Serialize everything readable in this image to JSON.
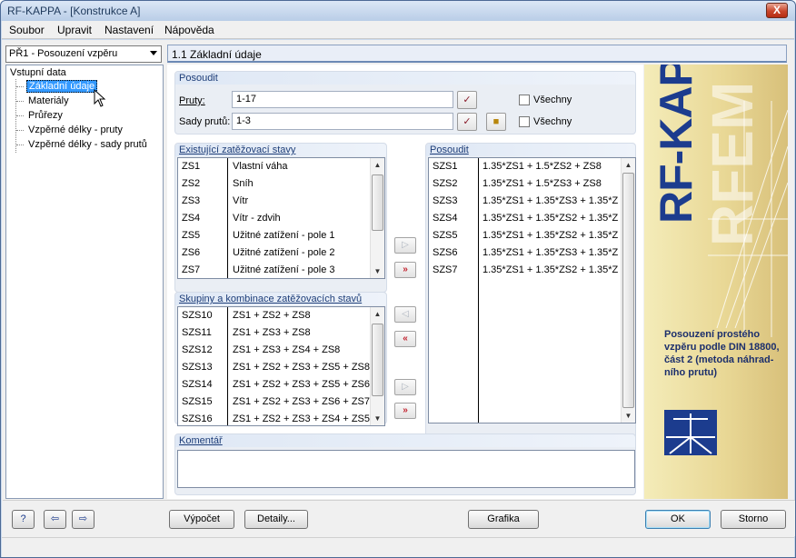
{
  "window": {
    "title": "RF-KAPPA - [Konstrukce A]",
    "close_glyph": "X"
  },
  "menu": [
    "Soubor",
    "Upravit",
    "Nastavení",
    "Nápověda"
  ],
  "case_select": {
    "value": "PŘ1 - Posouzení vzpěru"
  },
  "tree": {
    "root": "Vstupní data",
    "items": [
      "Základní údaje",
      "Materiály",
      "Průřezy",
      "Vzpěrné délky - pruty",
      "Vzpěrné délky - sady prutů"
    ],
    "selected_index": 0
  },
  "section_header": "1.1 Základní údaje",
  "posoudit": {
    "title": "Posoudit",
    "pruty_label": "Pruty:",
    "pruty_value": "1-17",
    "sady_label": "Sady prutů:",
    "sady_value": "1-3",
    "vsechny_label": "Všechny"
  },
  "existing": {
    "title": "Existující zatěžovací stavy",
    "rows": [
      [
        "ZS1",
        "Vlastní váha"
      ],
      [
        "ZS2",
        "Sníh"
      ],
      [
        "ZS3",
        "Vítr"
      ],
      [
        "ZS4",
        "Vítr - zdvih"
      ],
      [
        "ZS5",
        "Užitné zatížení - pole 1"
      ],
      [
        "ZS6",
        "Užitné zatížení - pole 2"
      ],
      [
        "ZS7",
        "Užitné zatížení - pole 3"
      ]
    ]
  },
  "groups": {
    "title": "Skupiny a kombinace zatěžovacích stavů",
    "rows": [
      [
        "SZS10",
        "ZS1 + ZS2 + ZS8"
      ],
      [
        "SZS11",
        "ZS1 + ZS3 + ZS8"
      ],
      [
        "SZS12",
        "ZS1 + ZS3 + ZS4 + ZS8"
      ],
      [
        "SZS13",
        "ZS1 + ZS2 + ZS3 + ZS5 + ZS8"
      ],
      [
        "SZS14",
        "ZS1 + ZS2 + ZS3 + ZS5 + ZS6"
      ],
      [
        "SZS15",
        "ZS1 + ZS2 + ZS3 + ZS6 + ZS7"
      ],
      [
        "SZS16",
        "ZS1 + ZS2 + ZS3 + ZS4 + ZS5"
      ]
    ]
  },
  "to_design": {
    "title": "Posoudit",
    "rows": [
      [
        "SZS1",
        "1.35*ZS1 + 1.5*ZS2 + ZS8"
      ],
      [
        "SZS2",
        "1.35*ZS1 + 1.5*ZS3 + ZS8"
      ],
      [
        "SZS3",
        "1.35*ZS1 + 1.35*ZS3 + 1.35*Z"
      ],
      [
        "SZS4",
        "1.35*ZS1 + 1.35*ZS2 + 1.35*Z"
      ],
      [
        "SZS5",
        "1.35*ZS1 + 1.35*ZS2 + 1.35*Z"
      ],
      [
        "SZS6",
        "1.35*ZS1 + 1.35*ZS3 + 1.35*Z"
      ],
      [
        "SZS7",
        "1.35*ZS1 + 1.35*ZS2 + 1.35*Z"
      ]
    ]
  },
  "comment": {
    "title": "Komentář",
    "value": ""
  },
  "side_panel": {
    "title": "RF-KAPPA",
    "ghost": "RFEM",
    "description": "Posouzení prostého vzpěru podle DIN 18800, část 2 (metoda náhrad-ního prutu)"
  },
  "buttons": {
    "calc": "Výpočet",
    "details": "Detaily...",
    "graphics": "Grafika",
    "ok": "OK",
    "cancel": "Storno"
  },
  "icons": {
    "help": "help-icon",
    "import": "import-icon",
    "export": "export-icon",
    "pick": "pick-icon",
    "new": "new-icon"
  },
  "colors": {
    "accent": "#1c3c8e",
    "arrow_red": "#c2202c"
  }
}
